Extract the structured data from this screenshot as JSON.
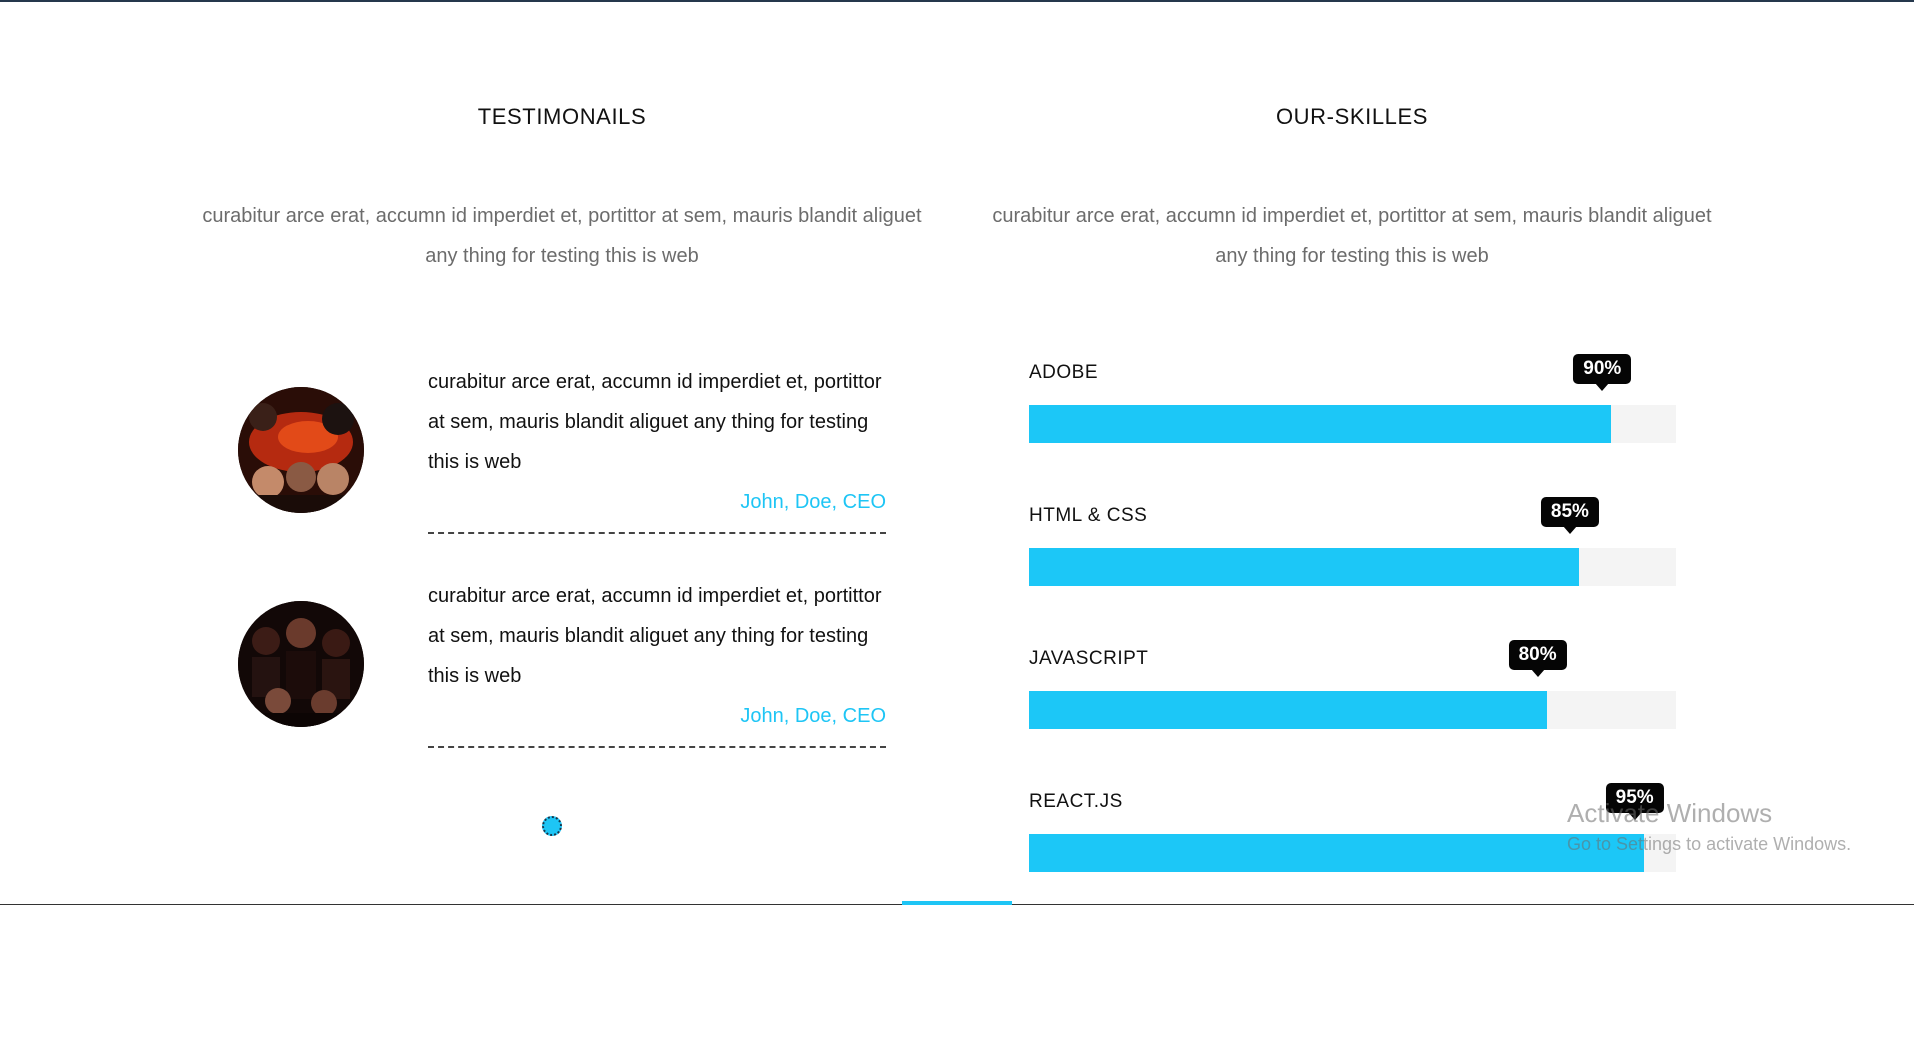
{
  "testimonials": {
    "title": "TESTIMONAILS",
    "subtitle": "curabitur arce erat, accumn id imperdiet et, portittor at sem, mauris blandit aliguet any thing for testing this is web",
    "items": [
      {
        "text": "curabitur arce erat, accumn id imperdiet et, portittor at sem, mauris blandit aliguet any thing for testing this is web",
        "author": "John, Doe, CEO",
        "avatar_icon": "group-photo-avatar"
      },
      {
        "text": "curabitur arce erat, accumn id imperdiet et, portittor at sem, mauris blandit aliguet any thing for testing this is web",
        "author": "John, Doe, CEO",
        "avatar_icon": "group-photo-avatar"
      }
    ]
  },
  "skills": {
    "title": "OUR-SKILLES",
    "subtitle": "curabitur arce erat, accumn id imperdiet et, portittor at sem, mauris blandit aliguet any thing for testing this is web",
    "items": [
      {
        "label": "ADOBE",
        "percent_label": "90%",
        "value": 90
      },
      {
        "label": "HTML & CSS",
        "percent_label": "85%",
        "value": 85
      },
      {
        "label": "JAVASCRIPT",
        "percent_label": "80%",
        "value": 80
      },
      {
        "label": "REACT.JS",
        "percent_label": "95%",
        "value": 95
      }
    ]
  },
  "watermark": {
    "title": "Activate Windows",
    "subtitle": "Go to Settings to activate Windows."
  },
  "colors": {
    "accent": "#1cc7f7",
    "badge": "#050505",
    "track": "#f4f4f4",
    "muted_text": "#6c6c6c"
  }
}
